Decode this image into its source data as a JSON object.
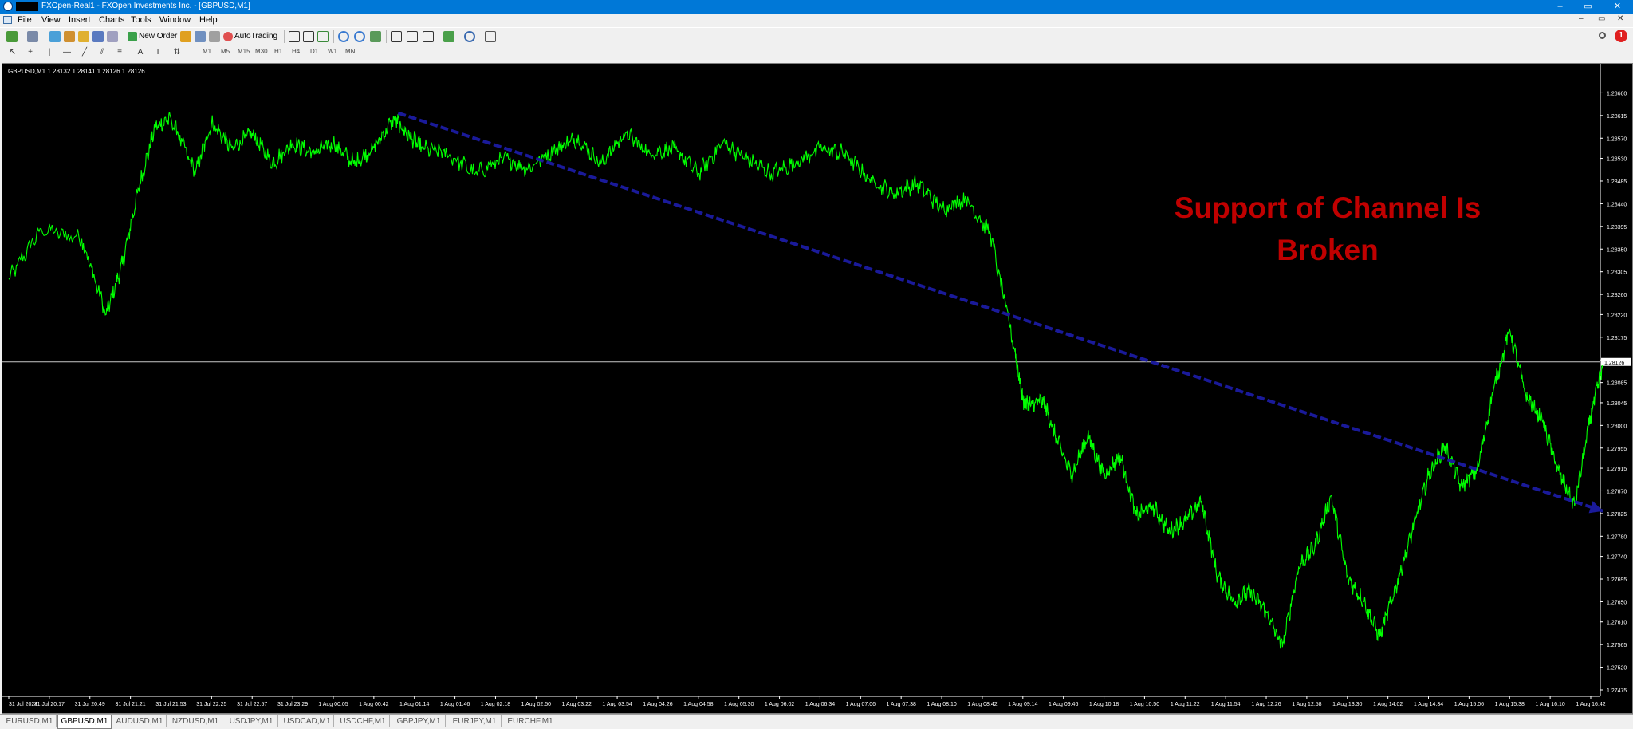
{
  "window": {
    "title": "FXOpen-Real1 - FXOpen Investments Inc. - [GBPUSD,M1]",
    "controls": [
      "–",
      "▭",
      "✕"
    ]
  },
  "menu": [
    "File",
    "View",
    "Insert",
    "Charts",
    "Tools",
    "Window",
    "Help"
  ],
  "toolbar": {
    "new_order_label": "New Order",
    "autotrading_label": "AutoTrading",
    "timeframes": [
      "M1",
      "M5",
      "M15",
      "M30",
      "H1",
      "H4",
      "D1",
      "W1",
      "MN"
    ],
    "notification_count": "1"
  },
  "chart": {
    "header": "GBPUSD,M1  1.28132 1.28141 1.28126 1.28126",
    "annotation_line1": "Support of Channel Is",
    "annotation_line2": "Broken",
    "annotation_color": "#c00000",
    "price_line_color": "#c8c8c8",
    "line_color": "#00ff00",
    "trendline_color": "#1a1a9a",
    "bid_label": "1.28126"
  },
  "chart_data": {
    "type": "line",
    "symbol": "GBPUSD",
    "timeframe": "M1",
    "ylim": [
      1.27475,
      1.28705
    ],
    "price_ticks": [
      "1.28660",
      "1.28615",
      "1.28570",
      "1.28530",
      "1.28485",
      "1.28440",
      "1.28395",
      "1.28350",
      "1.28305",
      "1.28260",
      "1.28220",
      "1.28175",
      "1.28130",
      "1.28085",
      "1.28045",
      "1.28000",
      "1.27955",
      "1.27915",
      "1.27870",
      "1.27825",
      "1.27780",
      "1.27740",
      "1.27695",
      "1.27650",
      "1.27610",
      "1.27565",
      "1.27520",
      "1.27475"
    ],
    "time_ticks": [
      "31 Jul 2024",
      "31 Jul 20:17",
      "31 Jul 20:49",
      "31 Jul 21:21",
      "31 Jul 21:53",
      "31 Jul 22:25",
      "31 Jul 22:57",
      "31 Jul 23:29",
      "1 Aug 00:05",
      "1 Aug 00:42",
      "1 Aug 01:14",
      "1 Aug 01:46",
      "1 Aug 02:18",
      "1 Aug 02:50",
      "1 Aug 03:22",
      "1 Aug 03:54",
      "1 Aug 04:26",
      "1 Aug 04:58",
      "1 Aug 05:30",
      "1 Aug 06:02",
      "1 Aug 06:34",
      "1 Aug 07:06",
      "1 Aug 07:38",
      "1 Aug 08:10",
      "1 Aug 08:42",
      "1 Aug 09:14",
      "1 Aug 09:46",
      "1 Aug 10:18",
      "1 Aug 10:50",
      "1 Aug 11:22",
      "1 Aug 11:54",
      "1 Aug 12:26",
      "1 Aug 12:58",
      "1 Aug 13:30",
      "1 Aug 14:02",
      "1 Aug 14:34",
      "1 Aug 15:06",
      "1 Aug 15:38",
      "1 Aug 16:10",
      "1 Aug 16:42"
    ],
    "series": [
      {
        "name": "GBPUSD,M1",
        "x": [
          0,
          0.8,
          1.8,
          2.4,
          2.8,
          3.2,
          3.6,
          4.0,
          4.6,
          5.0,
          5.5,
          6.0,
          6.5,
          7.0,
          7.5,
          8.0,
          8.5,
          9.0,
          9.5,
          9.8,
          10.2,
          10.8,
          11.5,
          12.2,
          12.8,
          13.5,
          14.0,
          14.6,
          15.2,
          15.8,
          16.4,
          17.0,
          17.6,
          18.2,
          18.8,
          19.4,
          20.0,
          20.6,
          21.2,
          21.8,
          22.4,
          23.0,
          23.6,
          24.2,
          24.8,
          25.0,
          25.2,
          25.5,
          25.8,
          26.2,
          26.6,
          27.0,
          27.4,
          27.8,
          28.2,
          28.6,
          29.0,
          29.4,
          29.8,
          30.2,
          30.6,
          31.0,
          31.4,
          31.8,
          32.2,
          32.6,
          33.0,
          33.4,
          33.8,
          34.2,
          34.6,
          35.0,
          35.4,
          35.8,
          36.2,
          36.6,
          37.0,
          37.4,
          37.8,
          38.2,
          38.6,
          39.0,
          39.3
        ],
        "y": [
          1.2829,
          1.2839,
          1.2837,
          1.2822,
          1.2832,
          1.2847,
          1.2859,
          1.2861,
          1.285,
          1.286,
          1.2855,
          1.2858,
          1.2852,
          1.2856,
          1.2854,
          1.2856,
          1.2852,
          1.2855,
          1.2861,
          1.2858,
          1.2855,
          1.2854,
          1.285,
          1.2853,
          1.2851,
          1.2855,
          1.2857,
          1.2852,
          1.2858,
          1.2854,
          1.2855,
          1.285,
          1.2856,
          1.2853,
          1.285,
          1.2852,
          1.2855,
          1.2854,
          1.2849,
          1.2846,
          1.2848,
          1.2843,
          1.2845,
          1.2838,
          1.2815,
          1.2805,
          1.2804,
          1.2805,
          1.2798,
          1.279,
          1.2798,
          1.279,
          1.2794,
          1.2782,
          1.2784,
          1.2779,
          1.2781,
          1.2785,
          1.277,
          1.2765,
          1.2767,
          1.2763,
          1.2756,
          1.2772,
          1.2776,
          1.2786,
          1.277,
          1.2765,
          1.2758,
          1.2768,
          1.2779,
          1.279,
          1.2796,
          1.2788,
          1.2791,
          1.2807,
          1.2819,
          1.2806,
          1.2801,
          1.2791,
          1.2784,
          1.2802,
          1.2812
        ]
      }
    ],
    "trendline": {
      "x": [
        9.6,
        39.3
      ],
      "y": [
        1.2862,
        1.2783
      ]
    },
    "horizontal_line": 1.28126,
    "grid": false
  },
  "tabs": [
    "EURUSD,M1",
    "GBPUSD,M1",
    "AUDUSD,M1",
    "NZDUSD,M1",
    "USDJPY,M1",
    "USDCAD,M1",
    "USDCHF,M1",
    "GBPJPY,M1",
    "EURJPY,M1",
    "EURCHF,M1"
  ],
  "active_tab": "GBPUSD,M1"
}
